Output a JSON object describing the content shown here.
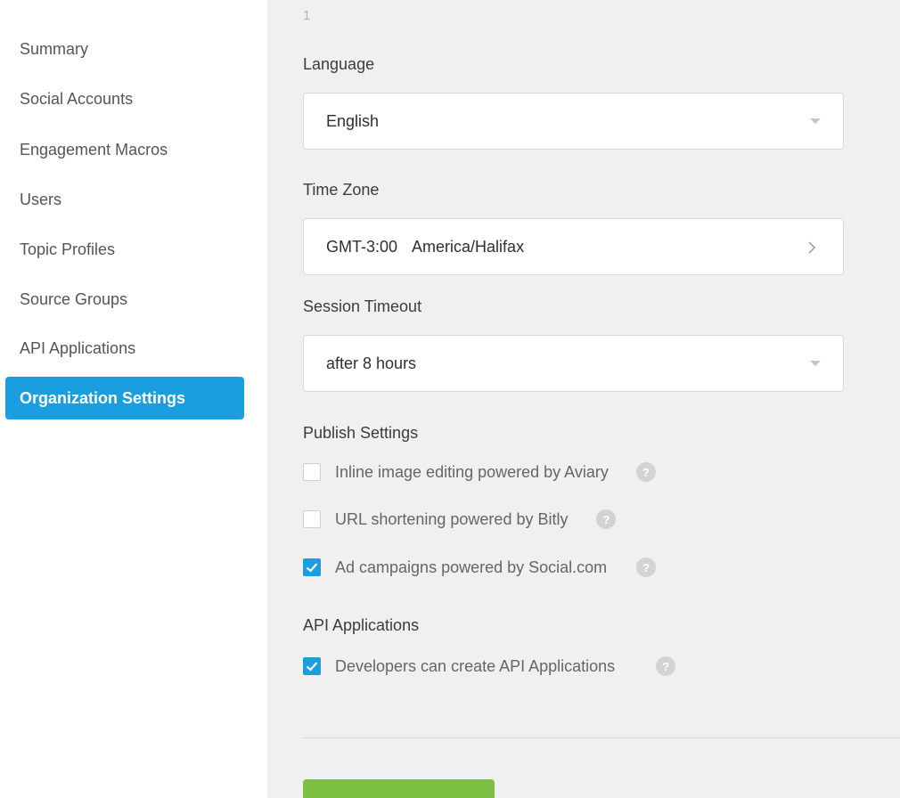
{
  "sidebar": {
    "items": [
      {
        "label": "Summary"
      },
      {
        "label": "Social Accounts"
      },
      {
        "label": "Engagement Macros"
      },
      {
        "label": "Users"
      },
      {
        "label": "Topic Profiles"
      },
      {
        "label": "Source Groups"
      },
      {
        "label": "API Applications"
      },
      {
        "label": "Organization Settings",
        "active": true
      }
    ]
  },
  "main": {
    "page_number": "1",
    "language": {
      "label": "Language",
      "value": "English"
    },
    "time_zone": {
      "label": "Time Zone",
      "offset": "GMT-3:00",
      "zone": "America/Halifax"
    },
    "session_timeout": {
      "label": "Session Timeout",
      "value": "after 8 hours"
    },
    "publish_settings": {
      "label": "Publish Settings",
      "options": [
        {
          "label": "Inline image editing powered by Aviary",
          "checked": false
        },
        {
          "label": "URL shortening powered by Bitly",
          "checked": false
        },
        {
          "label": "Ad campaigns powered by Social.com",
          "checked": true
        }
      ]
    },
    "api_applications": {
      "label": "API Applications",
      "options": [
        {
          "label": "Developers can create API Applications",
          "checked": true
        }
      ]
    },
    "help_glyph": "?"
  },
  "colors": {
    "accent": "#1a9ee0",
    "save_button": "#7cc144",
    "panel_background": "#f0f0f0"
  },
  "icons": [
    "caret-down-icon",
    "chevron-right-icon",
    "checkmark-icon",
    "help-icon"
  ]
}
